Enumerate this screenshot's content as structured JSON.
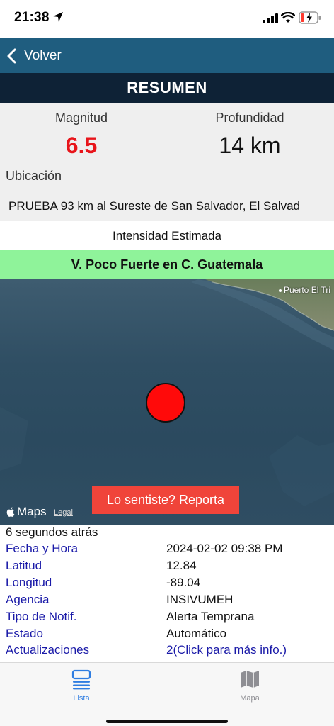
{
  "status_bar": {
    "time": "21:38"
  },
  "nav": {
    "back_label": "Volver"
  },
  "title": "RESUMEN",
  "summary": {
    "magnitude_label": "Magnitud",
    "magnitude_value": "6.5",
    "depth_label": "Profundidad",
    "depth_value": "14 km",
    "location_label": "Ubicación",
    "location_value": "PRUEBA 93 km al Sureste de San Salvador, El Salvad"
  },
  "intensity": {
    "label": "Intensidad Estimada",
    "value": "V. Poco Fuerte en C. Guatemala"
  },
  "map": {
    "place_label": "Puerto El Tri",
    "report_button": "Lo sentiste? Reporta",
    "maps_brand": "Maps",
    "legal": "Legal"
  },
  "details": {
    "ago": "6 segundos atrás",
    "rows": [
      {
        "key": "Fecha y Hora",
        "value": "2024-02-02 09:38 PM"
      },
      {
        "key": "Latitud",
        "value": "12.84"
      },
      {
        "key": "Longitud",
        "value": "-89.04"
      },
      {
        "key": "Agencia",
        "value": "INSIVUMEH"
      },
      {
        "key": "Tipo de Notif.",
        "value": "Alerta Temprana"
      },
      {
        "key": "Estado",
        "value": "Automático"
      },
      {
        "key": "Actualizaciones",
        "value": "2(Click para más info.)"
      }
    ]
  },
  "tabs": {
    "lista": "Lista",
    "mapa": "Mapa"
  },
  "colors": {
    "nav": "#1f5d7f",
    "title_bar": "#0e2236",
    "magnitude": "#e8141a",
    "intensity_bg": "#8ff39a",
    "report_button": "#f0443a",
    "link": "#1a1aa8",
    "tab_active": "#2f7de1"
  }
}
